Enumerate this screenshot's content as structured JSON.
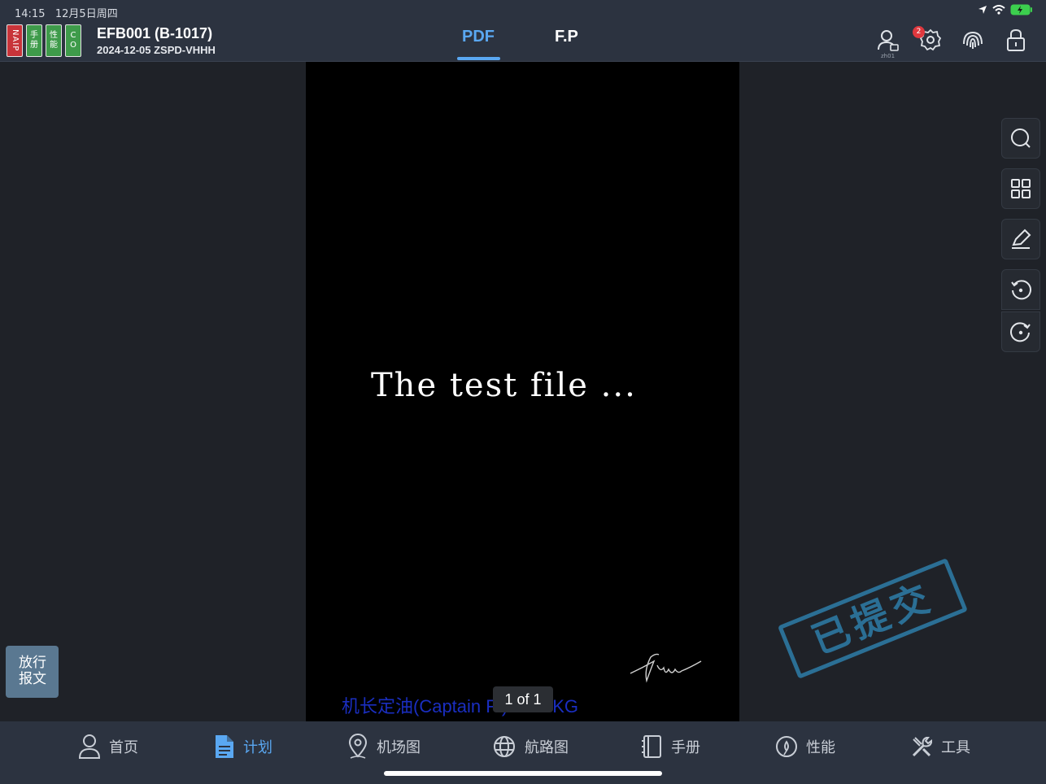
{
  "status_bar": {
    "time": "14:15",
    "date": "12月5日周四"
  },
  "header": {
    "quick_tabs": [
      {
        "label": "NAIP",
        "color": "#c8343a"
      },
      {
        "label": "手册",
        "color": "#3e9b4a"
      },
      {
        "label": "性能",
        "color": "#3e9b4a"
      },
      {
        "label": "CO",
        "color": "#3e9b4a"
      }
    ],
    "flight_title": "EFB001 (B-1017)",
    "flight_sub": "2024-12-05 ZSPD-VHHH",
    "tabs": [
      {
        "label": "PDF",
        "active": true
      },
      {
        "label": "F.P",
        "active": false
      }
    ],
    "user_caption": "zh01",
    "settings_badge": "2"
  },
  "document": {
    "text": "The test file ...",
    "note": "机长定油(Captain F   )3000 KG",
    "page_indicator": "1 of 1",
    "stamp": "已提交"
  },
  "side_button": {
    "line1": "放行",
    "line2": "报文"
  },
  "bottom_tabs": [
    {
      "label": "首页",
      "icon": "user-icon",
      "active": false
    },
    {
      "label": "计划",
      "icon": "document-icon",
      "active": true
    },
    {
      "label": "机场图",
      "icon": "map-pin-icon",
      "active": false
    },
    {
      "label": "航路图",
      "icon": "globe-icon",
      "active": false
    },
    {
      "label": "手册",
      "icon": "book-icon",
      "active": false
    },
    {
      "label": "性能",
      "icon": "gauge-icon",
      "active": false
    },
    {
      "label": "工具",
      "icon": "tools-icon",
      "active": false
    }
  ],
  "colors": {
    "accent": "#5aa8f2",
    "bar": "#2c3340",
    "background": "#1f2228"
  }
}
